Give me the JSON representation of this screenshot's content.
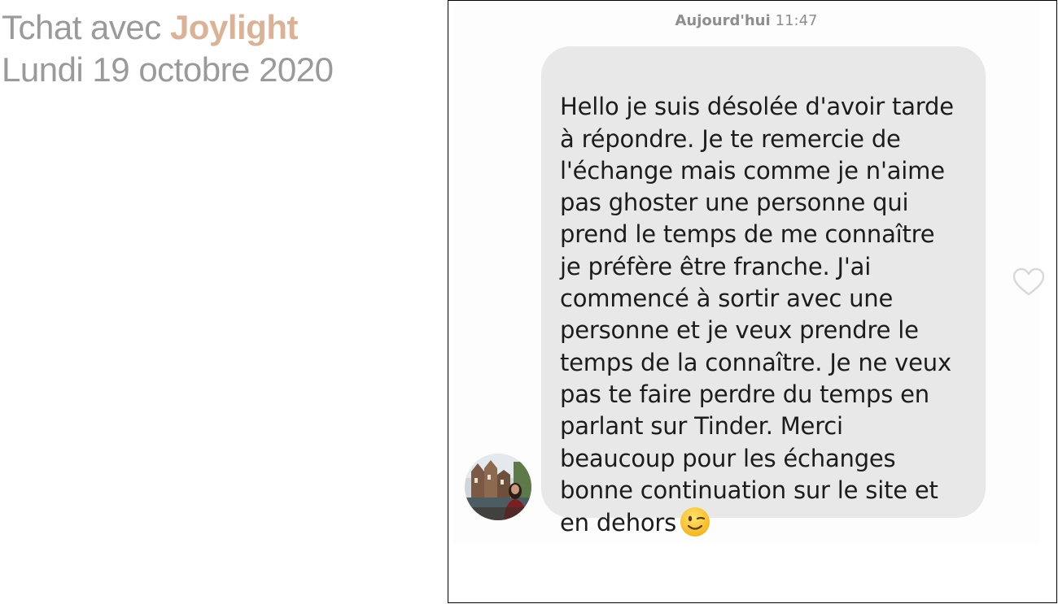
{
  "header": {
    "prefix": "Tchat avec ",
    "contact_name": "Joylight",
    "date": "Lundi 19 octobre 2020"
  },
  "chat": {
    "timestamp_day": "Aujourd'hui",
    "timestamp_time": "11:47",
    "message": {
      "text": "Hello je suis désolée d'avoir tarde\nà répondre. Je te remercie de\nl'échange mais comme je n'aime\npas ghoster une personne qui\nprend le temps de me connaître\nje préfère être franche. J'ai\ncommencé à sortir avec une\npersonne et je veux prendre le\ntemps de la connaître. Je ne veux\npas te faire perdre du temps en\nparlant sur Tinder. Merci\nbeaucoup pour les échanges\nbonne continuation sur le site et\nen dehors",
      "emoji": "winking-face-icon"
    },
    "icons": {
      "like": "heart-outline-icon",
      "avatar": "contact-avatar"
    }
  },
  "colors": {
    "heading_gray": "#9a9a9a",
    "name_accent": "#dcb296",
    "bubble_bg": "#e8e8e8",
    "timestamp_gray": "#8e8e8e"
  }
}
